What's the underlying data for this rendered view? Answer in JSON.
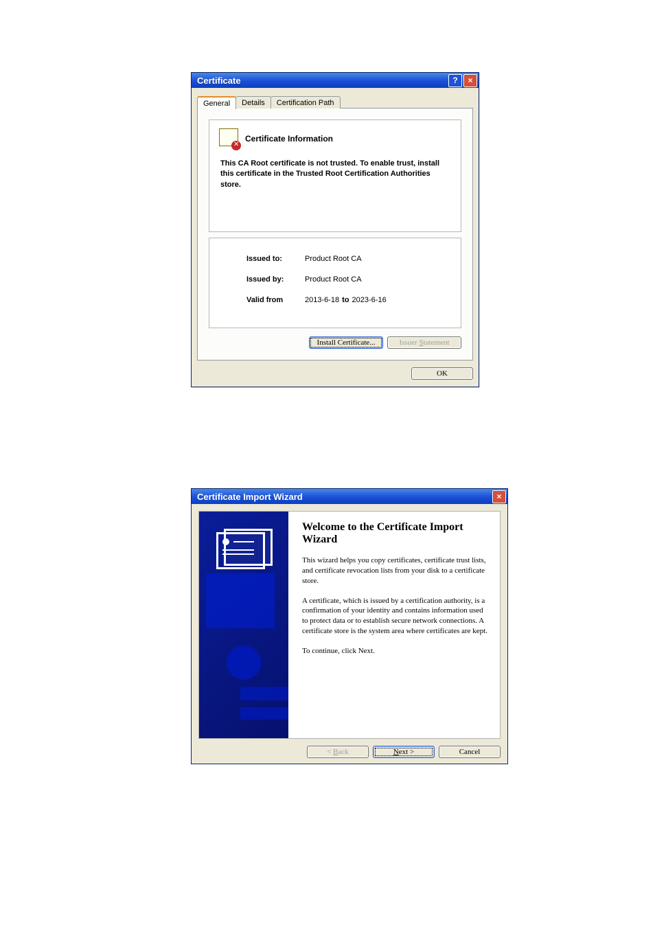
{
  "certDialog": {
    "title": "Certificate",
    "tabs": {
      "general": "General",
      "details": "Details",
      "path": "Certification Path"
    },
    "infoHeading": "Certificate Information",
    "trustMsg": "This CA Root certificate is not trusted. To enable trust, install this certificate in the Trusted Root Certification Authorities store.",
    "issuedToLabel": "Issued to:",
    "issuedTo": "Product Root CA",
    "issuedByLabel": "Issued by:",
    "issuedBy": "Product Root CA",
    "validFromLabel": "Valid from",
    "validFrom": "2013-6-18",
    "toLabel": "to",
    "validTo": "2023-6-16",
    "installBtn": "Install Certificate...",
    "issuerBtn": "Issuer Statement",
    "okBtn": "OK"
  },
  "wizard": {
    "title": "Certificate Import Wizard",
    "heading": "Welcome to the Certificate Import Wizard",
    "p1": "This wizard helps you copy certificates, certificate trust lists, and certificate revocation lists from your disk to a certificate store.",
    "p2": "A certificate, which is issued by a certification authority, is a confirmation of your identity and contains information used to protect data or to establish secure network connections. A certificate store is the system area where certificates are kept.",
    "p3": "To continue, click Next.",
    "backBtn": "< Back",
    "nextBtn": "Next >",
    "cancelBtn": "Cancel"
  }
}
